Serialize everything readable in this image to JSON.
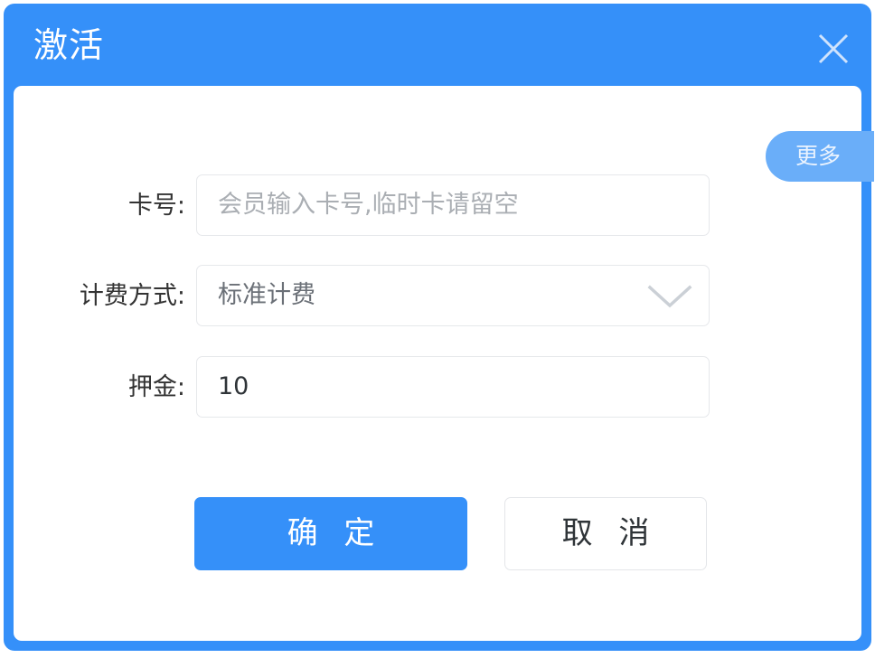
{
  "dialog": {
    "title": "激活",
    "close_icon": "close-icon",
    "accent_color": "#3590f9",
    "panel_color": "#ffffff"
  },
  "side_tab": {
    "label": "更多",
    "color": "#6aaef9"
  },
  "form": {
    "rows": [
      {
        "label": "卡号:",
        "type": "text",
        "value": "",
        "placeholder": "会员输入卡号,临时卡请留空"
      },
      {
        "label": "计费方式:",
        "type": "select",
        "value": "标准计费",
        "placeholder": "",
        "icon": "chevron-down-icon"
      },
      {
        "label": "押金:",
        "type": "text",
        "value": "10",
        "placeholder": ""
      }
    ]
  },
  "buttons": {
    "confirm": "确 定",
    "cancel": "取 消"
  }
}
